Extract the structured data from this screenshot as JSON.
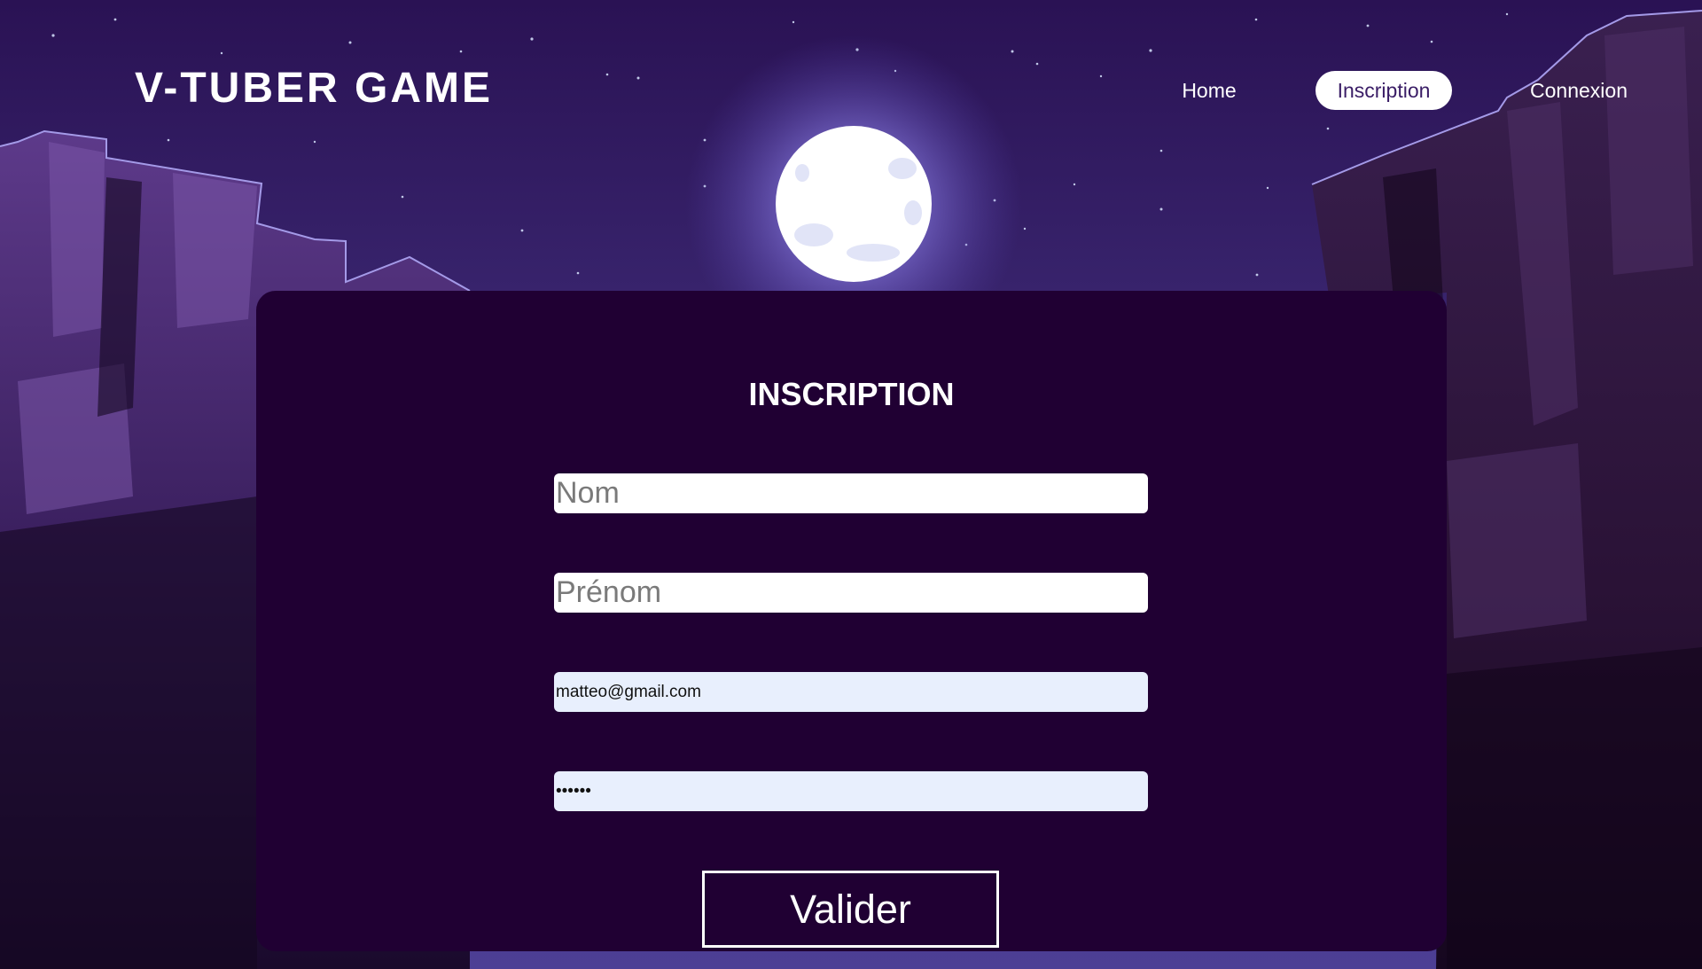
{
  "header": {
    "logo": "V-TUBER GAME",
    "nav": [
      {
        "label": "Home",
        "active": false
      },
      {
        "label": "Inscription",
        "active": true
      },
      {
        "label": "Connexion",
        "active": false
      }
    ]
  },
  "form": {
    "title": "INSCRIPTION",
    "nom": {
      "placeholder": "Nom",
      "value": ""
    },
    "prenom": {
      "placeholder": "Prénom",
      "value": ""
    },
    "email": {
      "value": "matteo@gmail.com"
    },
    "password": {
      "value": "••••••"
    },
    "submit_label": "Valider"
  },
  "colors": {
    "card": "#200033",
    "sky_top": "#2a1254",
    "sky_bottom": "#4a3a8e",
    "moon": "#ffffff",
    "active_nav_text": "#3a1d66",
    "autofill": "#e8effd"
  }
}
